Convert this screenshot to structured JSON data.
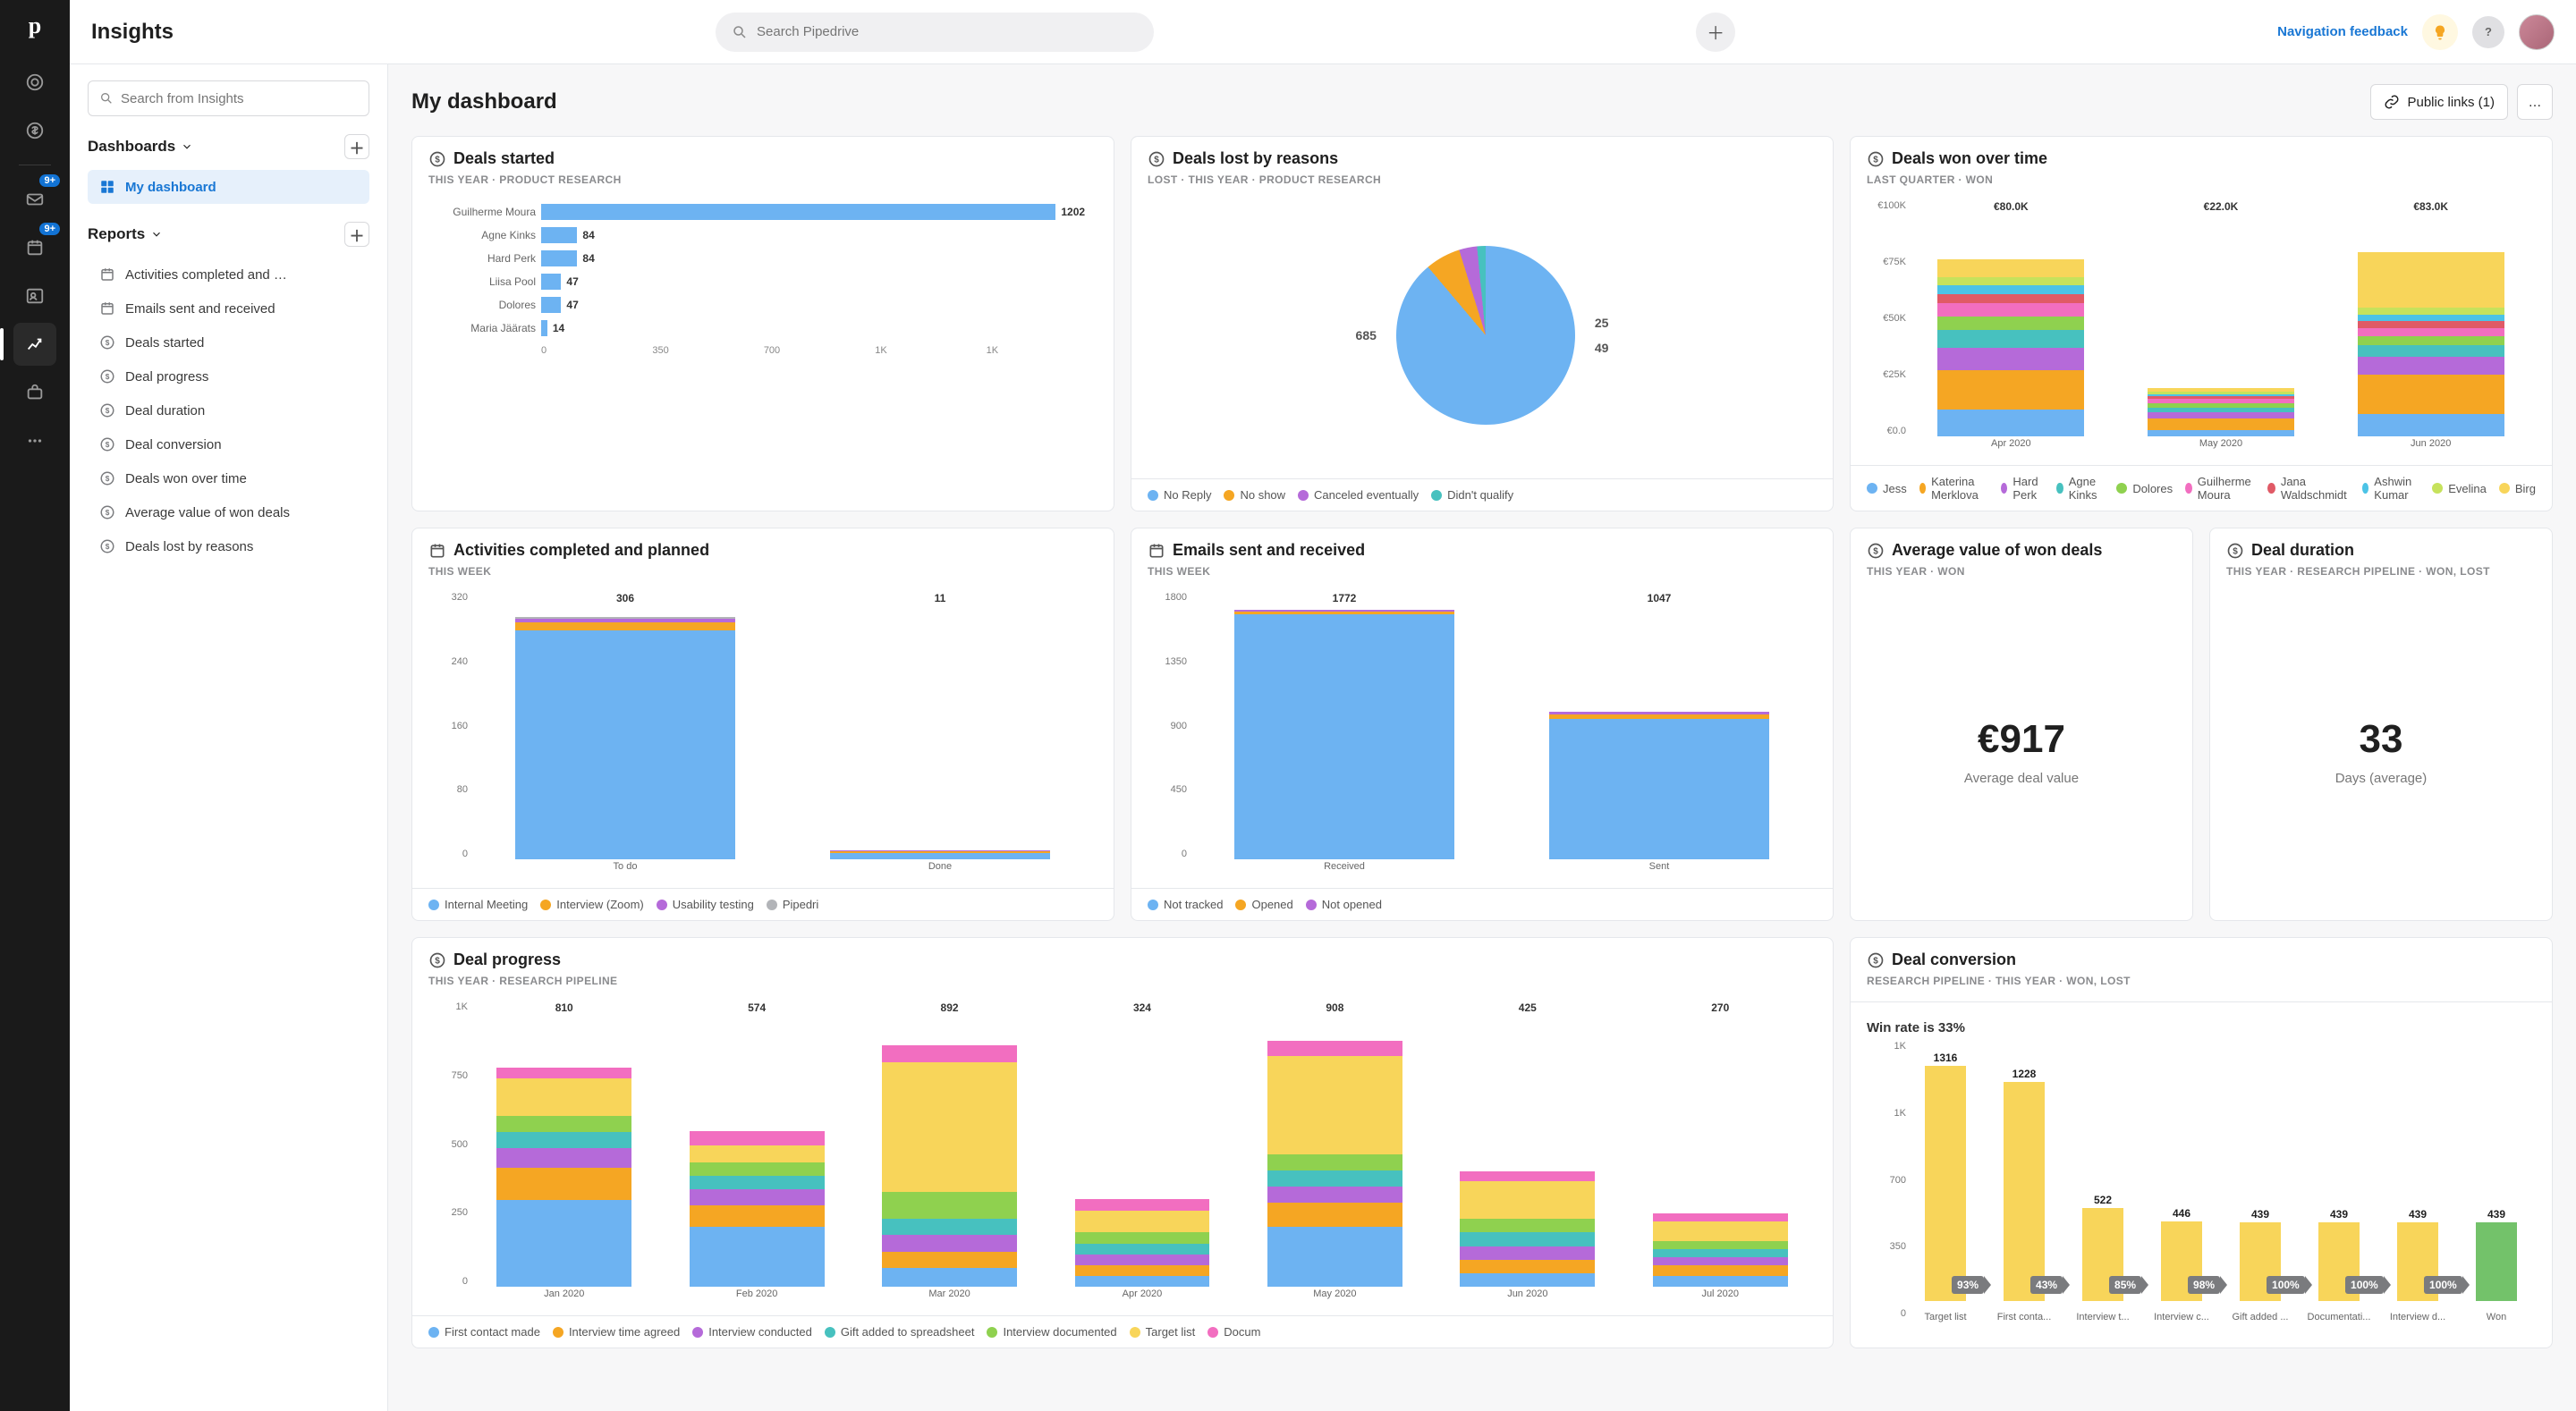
{
  "app": {
    "title": "Insights"
  },
  "search": {
    "placeholder": "Search Pipedrive"
  },
  "topright": {
    "feedback": "Navigation feedback",
    "help_glyph": "?"
  },
  "sidebar": {
    "search_placeholder": "Search from Insights",
    "dashboards_label": "Dashboards",
    "reports_label": "Reports",
    "dashboard_items": [
      {
        "label": "My dashboard"
      }
    ],
    "report_items": [
      {
        "label": "Activities completed and …",
        "icon": "calendar"
      },
      {
        "label": "Emails sent and received",
        "icon": "calendar"
      },
      {
        "label": "Deals started",
        "icon": "money"
      },
      {
        "label": "Deal progress",
        "icon": "money"
      },
      {
        "label": "Deal duration",
        "icon": "money"
      },
      {
        "label": "Deal conversion",
        "icon": "money"
      },
      {
        "label": "Deals won over time",
        "icon": "money"
      },
      {
        "label": "Average value of won deals",
        "icon": "money"
      },
      {
        "label": "Deals lost by reasons",
        "icon": "money"
      }
    ]
  },
  "rail_badges": {
    "mail": "9+",
    "activities": "9+"
  },
  "header": {
    "title": "My dashboard",
    "public_links": "Public links (1)",
    "menu_glyph": "…"
  },
  "palette": {
    "blue": "#6db3f2",
    "orange": "#f5a623",
    "purple": "#b56ad9",
    "teal": "#47c1bf",
    "green": "#8fd14f",
    "pink": "#f26ec0",
    "yellow": "#f8d55a",
    "red": "#e05a66",
    "cyan": "#4cc3e6",
    "grey": "#b2b4b8",
    "green2": "#73c26a",
    "lime": "#c6e25c"
  },
  "cards": {
    "deals_started": {
      "title": "Deals started",
      "sub": "THIS YEAR   ·   PRODUCT RESEARCH",
      "max": 1300,
      "axis": [
        "0",
        "350",
        "700",
        "1K",
        "1K"
      ],
      "rows": [
        {
          "label": "Guilherme Moura",
          "value": 1202
        },
        {
          "label": "Agne Kinks",
          "value": 84
        },
        {
          "label": "Hard Perk",
          "value": 84
        },
        {
          "label": "Liisa Pool",
          "value": 47
        },
        {
          "label": "Dolores",
          "value": 47
        },
        {
          "label": "Maria Jäärats",
          "value": 14
        }
      ]
    },
    "deals_lost": {
      "title": "Deals lost by reasons",
      "sub": "LOST   ·   THIS YEAR   ·   PRODUCT RESEARCH",
      "slices": [
        {
          "label": "No Reply",
          "value": 685,
          "color": "blue"
        },
        {
          "label": "No show",
          "value": 49,
          "color": "orange"
        },
        {
          "label": "Canceled eventually",
          "value": 25,
          "color": "purple"
        },
        {
          "label": "Didn't qualify",
          "value": 12,
          "color": "teal"
        }
      ],
      "side_labels": [
        {
          "n": "685"
        },
        {
          "n": "25"
        },
        {
          "n": "49"
        }
      ],
      "legend": [
        "No Reply",
        "No show",
        "Canceled eventually",
        "Didn't qualify"
      ]
    },
    "deals_won": {
      "title": "Deals won over time",
      "sub": "LAST QUARTER   ·   WON",
      "ymax": 100,
      "yticks": [
        "€100K",
        "€75K",
        "€50K",
        "€25K",
        "€0.0"
      ],
      "categories": [
        "Apr 2020",
        "May 2020",
        "Jun 2020"
      ],
      "totals": [
        "€80.0K",
        "€22.0K",
        "€83.0K"
      ],
      "legend": [
        "Jess",
        "Katerina Merklova",
        "Hard Perk",
        "Agne Kinks",
        "Dolores",
        "Guilherme Moura",
        "Jana Waldschmidt",
        "Ashwin Kumar",
        "Evelina",
        "Birg"
      ],
      "series": [
        {
          "name": "Jess",
          "color": "blue",
          "values": [
            12,
            3,
            10
          ]
        },
        {
          "name": "Katerina Merklova",
          "color": "orange",
          "values": [
            18,
            5,
            18
          ]
        },
        {
          "name": "Hard Perk",
          "color": "purple",
          "values": [
            10,
            3,
            8
          ]
        },
        {
          "name": "Agne Kinks",
          "color": "teal",
          "values": [
            8,
            2,
            5
          ]
        },
        {
          "name": "Dolores",
          "color": "green",
          "values": [
            6,
            2,
            4
          ]
        },
        {
          "name": "Guilherme Moura",
          "color": "pink",
          "values": [
            6,
            2,
            4
          ]
        },
        {
          "name": "Jana Waldschmidt",
          "color": "red",
          "values": [
            4,
            1,
            3
          ]
        },
        {
          "name": "Ashwin Kumar",
          "color": "cyan",
          "values": [
            4,
            1,
            3
          ]
        },
        {
          "name": "Evelina",
          "color": "lime",
          "values": [
            4,
            1,
            3
          ]
        },
        {
          "name": "Birg",
          "color": "yellow",
          "values": [
            8,
            2,
            25
          ]
        }
      ]
    },
    "activities": {
      "title": "Activities completed and planned",
      "sub": "THIS WEEK",
      "ymax": 320,
      "yticks": [
        "320",
        "240",
        "160",
        "80",
        "0"
      ],
      "categories": [
        "To do",
        "Done"
      ],
      "totals": [
        "306",
        "11"
      ],
      "series": [
        {
          "name": "Internal Meeting",
          "color": "blue",
          "values": [
            290,
            8
          ]
        },
        {
          "name": "Interview (Zoom)",
          "color": "orange",
          "values": [
            10,
            2
          ]
        },
        {
          "name": "Usability testing",
          "color": "purple",
          "values": [
            4,
            1
          ]
        },
        {
          "name": "Pipedri",
          "color": "grey",
          "values": [
            2,
            0
          ]
        }
      ],
      "legend": [
        "Internal Meeting",
        "Interview (Zoom)",
        "Usability testing",
        "Pipedri"
      ]
    },
    "emails": {
      "title": "Emails sent and received",
      "sub": "THIS WEEK",
      "ymax": 1800,
      "yticks": [
        "1800",
        "1350",
        "900",
        "450",
        "0"
      ],
      "categories": [
        "Received",
        "Sent"
      ],
      "totals": [
        "1772",
        "1047"
      ],
      "series": [
        {
          "name": "Not tracked",
          "color": "blue",
          "values": [
            1740,
            1000
          ]
        },
        {
          "name": "Opened",
          "color": "orange",
          "values": [
            20,
            30
          ]
        },
        {
          "name": "Not opened",
          "color": "purple",
          "values": [
            12,
            17
          ]
        }
      ],
      "legend": [
        "Not tracked",
        "Opened",
        "Not opened"
      ]
    },
    "avg_value": {
      "title": "Average value of won deals",
      "sub": "THIS YEAR   ·   WON",
      "value": "€917",
      "label": "Average deal value"
    },
    "duration": {
      "title": "Deal duration",
      "sub": "THIS YEAR   ·   RESEARCH PIPELINE   ·   WON, LOST",
      "value": "33",
      "label": "Days (average)"
    },
    "progress": {
      "title": "Deal progress",
      "sub": "THIS YEAR   ·   RESEARCH PIPELINE",
      "ymax": 1000,
      "yticks": [
        "1K",
        "750",
        "500",
        "250",
        "0"
      ],
      "categories": [
        "Jan 2020",
        "Feb 2020",
        "Mar 2020",
        "Apr 2020",
        "May 2020",
        "Jun 2020",
        "Jul 2020"
      ],
      "totals": [
        "810",
        "574",
        "892",
        "324",
        "908",
        "425",
        "270"
      ],
      "series": [
        {
          "name": "First contact made",
          "color": "blue",
          "values": [
            320,
            220,
            70,
            40,
            220,
            50,
            40
          ]
        },
        {
          "name": "Interview time agreed",
          "color": "orange",
          "values": [
            120,
            80,
            60,
            40,
            90,
            50,
            40
          ]
        },
        {
          "name": "Interview conducted",
          "color": "purple",
          "values": [
            70,
            60,
            60,
            40,
            60,
            50,
            30
          ]
        },
        {
          "name": "Gift added to spreadsheet",
          "color": "teal",
          "values": [
            60,
            50,
            60,
            40,
            60,
            50,
            30
          ]
        },
        {
          "name": "Interview documented",
          "color": "green",
          "values": [
            60,
            50,
            100,
            40,
            60,
            50,
            30
          ]
        },
        {
          "name": "Target list",
          "color": "yellow",
          "values": [
            140,
            60,
            480,
            80,
            360,
            140,
            70
          ]
        },
        {
          "name": "Docum",
          "color": "pink",
          "values": [
            40,
            54,
            62,
            44,
            58,
            35,
            30
          ]
        }
      ],
      "legend": [
        "First contact made",
        "Interview time agreed",
        "Interview conducted",
        "Gift added to spreadsheet",
        "Interview documented",
        "Target list",
        "Docum"
      ]
    },
    "conversion": {
      "title": "Deal conversion",
      "sub": "RESEARCH PIPELINE   ·   THIS YEAR   ·   WON, LOST",
      "winrate": "Win rate is 33%",
      "ymax": 1316,
      "yticks": [
        "1K",
        "1K",
        "700",
        "350",
        "0"
      ],
      "stages": [
        {
          "label": "Target list",
          "value": 1316,
          "pct": "93%"
        },
        {
          "label": "First conta...",
          "value": 1228,
          "pct": "43%"
        },
        {
          "label": "Interview t...",
          "value": 522,
          "pct": "85%"
        },
        {
          "label": "Interview c...",
          "value": 446,
          "pct": "98%"
        },
        {
          "label": "Gift added ...",
          "value": 439,
          "pct": "100%"
        },
        {
          "label": "Documentati...",
          "value": 439,
          "pct": "100%"
        },
        {
          "label": "Interview d...",
          "value": 439,
          "pct": "100%"
        },
        {
          "label": "Won",
          "value": 439,
          "pct": "",
          "won": true
        }
      ]
    }
  },
  "chart_data": [
    {
      "type": "bar",
      "orientation": "horizontal",
      "title": "Deals started",
      "categories": [
        "Guilherme Moura",
        "Agne Kinks",
        "Hard Perk",
        "Liisa Pool",
        "Dolores",
        "Maria Jäärats"
      ],
      "values": [
        1202,
        84,
        84,
        47,
        47,
        14
      ],
      "xlim": [
        0,
        1300
      ]
    },
    {
      "type": "pie",
      "title": "Deals lost by reasons",
      "categories": [
        "No Reply",
        "No show",
        "Canceled eventually",
        "Didn't qualify"
      ],
      "values": [
        685,
        49,
        25,
        12
      ]
    },
    {
      "type": "bar",
      "title": "Deals won over time",
      "categories": [
        "Apr 2020",
        "May 2020",
        "Jun 2020"
      ],
      "series": [
        {
          "name": "Jess",
          "values": [
            12,
            3,
            10
          ]
        },
        {
          "name": "Katerina Merklova",
          "values": [
            18,
            5,
            18
          ]
        },
        {
          "name": "Hard Perk",
          "values": [
            10,
            3,
            8
          ]
        },
        {
          "name": "Agne Kinks",
          "values": [
            8,
            2,
            5
          ]
        },
        {
          "name": "Dolores",
          "values": [
            6,
            2,
            4
          ]
        },
        {
          "name": "Guilherme Moura",
          "values": [
            6,
            2,
            4
          ]
        },
        {
          "name": "Jana Waldschmidt",
          "values": [
            4,
            1,
            3
          ]
        },
        {
          "name": "Ashwin Kumar",
          "values": [
            4,
            1,
            3
          ]
        },
        {
          "name": "Evelina",
          "values": [
            4,
            1,
            3
          ]
        },
        {
          "name": "Birg",
          "values": [
            8,
            2,
            25
          ]
        }
      ],
      "ylim": [
        0,
        100
      ],
      "ylabel": "€K"
    },
    {
      "type": "bar",
      "title": "Activities completed and planned",
      "categories": [
        "To do",
        "Done"
      ],
      "series": [
        {
          "name": "Internal Meeting",
          "values": [
            290,
            8
          ]
        },
        {
          "name": "Interview (Zoom)",
          "values": [
            10,
            2
          ]
        },
        {
          "name": "Usability testing",
          "values": [
            4,
            1
          ]
        },
        {
          "name": "Pipedrive",
          "values": [
            2,
            0
          ]
        }
      ],
      "ylim": [
        0,
        320
      ]
    },
    {
      "type": "bar",
      "title": "Emails sent and received",
      "categories": [
        "Received",
        "Sent"
      ],
      "series": [
        {
          "name": "Not tracked",
          "values": [
            1740,
            1000
          ]
        },
        {
          "name": "Opened",
          "values": [
            20,
            30
          ]
        },
        {
          "name": "Not opened",
          "values": [
            12,
            17
          ]
        }
      ],
      "ylim": [
        0,
        1800
      ]
    },
    {
      "type": "bar",
      "title": "Deal progress",
      "categories": [
        "Jan 2020",
        "Feb 2020",
        "Mar 2020",
        "Apr 2020",
        "May 2020",
        "Jun 2020",
        "Jul 2020"
      ],
      "series": [
        {
          "name": "First contact made",
          "values": [
            320,
            220,
            70,
            40,
            220,
            50,
            40
          ]
        },
        {
          "name": "Interview time agreed",
          "values": [
            120,
            80,
            60,
            40,
            90,
            50,
            40
          ]
        },
        {
          "name": "Interview conducted",
          "values": [
            70,
            60,
            60,
            40,
            60,
            50,
            30
          ]
        },
        {
          "name": "Gift added to spreadsheet",
          "values": [
            60,
            50,
            60,
            40,
            60,
            50,
            30
          ]
        },
        {
          "name": "Interview documented",
          "values": [
            60,
            50,
            100,
            40,
            60,
            50,
            30
          ]
        },
        {
          "name": "Target list",
          "values": [
            140,
            60,
            480,
            80,
            360,
            140,
            70
          ]
        },
        {
          "name": "Documentation",
          "values": [
            40,
            54,
            62,
            44,
            58,
            35,
            30
          ]
        }
      ],
      "ylim": [
        0,
        1000
      ]
    },
    {
      "type": "bar",
      "title": "Deal conversion",
      "categories": [
        "Target list",
        "First contact",
        "Interview time",
        "Interview conducted",
        "Gift added",
        "Documentation",
        "Interview documented",
        "Won"
      ],
      "values": [
        1316,
        1228,
        522,
        446,
        439,
        439,
        439,
        439
      ],
      "annotations": [
        "93%",
        "43%",
        "85%",
        "98%",
        "100%",
        "100%",
        "100%",
        ""
      ],
      "note": "Win rate is 33%",
      "ylim": [
        0,
        1316
      ]
    }
  ]
}
